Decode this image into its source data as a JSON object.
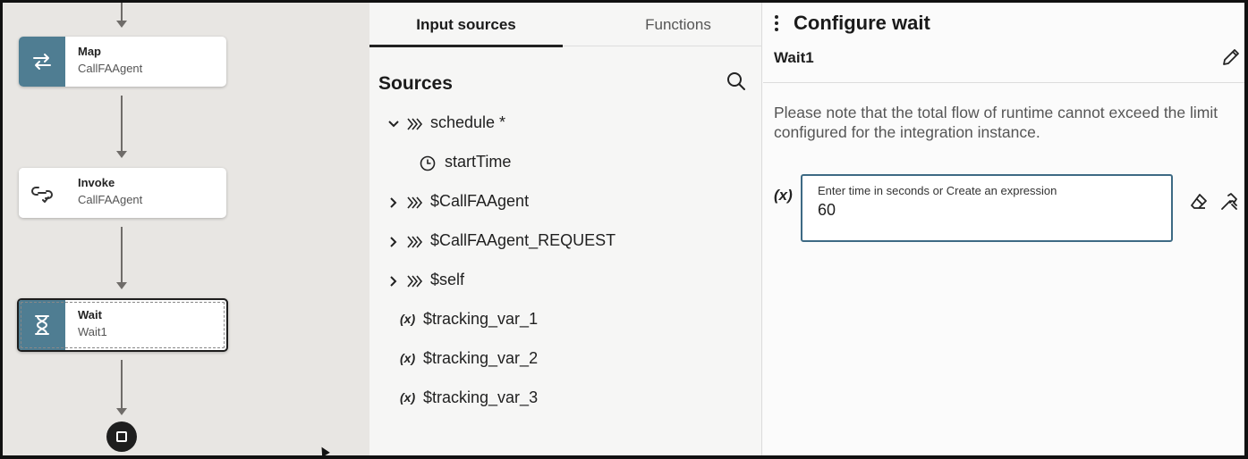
{
  "canvas": {
    "nodes": [
      {
        "icon": "map-arrows-icon",
        "title": "Map",
        "subtitle": "CallFAAgent"
      },
      {
        "icon": "invoke-link-icon",
        "title": "Invoke",
        "subtitle": "CallFAAgent"
      },
      {
        "icon": "hourglass-icon",
        "title": "Wait",
        "subtitle": "Wait1",
        "selected": true
      }
    ],
    "end_icon": "stop-square-icon",
    "accent": "#4f7d92"
  },
  "mapper": {
    "tabs": [
      {
        "label": "Input sources",
        "active": true
      },
      {
        "label": "Functions",
        "active": false
      }
    ],
    "sources_title": "Sources",
    "search_icon": "search-icon",
    "tree": [
      {
        "label": "schedule *",
        "icon": "object-icon",
        "expanded": true
      },
      {
        "label": "startTime",
        "icon": "clock-icon"
      },
      {
        "label": "$CallFAAgent",
        "icon": "object-icon",
        "expanded": false
      },
      {
        "label": "$CallFAAgent_REQUEST",
        "icon": "object-icon",
        "expanded": false
      },
      {
        "label": "$self",
        "icon": "object-icon",
        "expanded": false
      },
      {
        "label": "$tracking_var_1",
        "icon": "variable-icon",
        "glyph": "(x)"
      },
      {
        "label": "$tracking_var_2",
        "icon": "variable-icon",
        "glyph": "(x)"
      },
      {
        "label": "$tracking_var_3",
        "icon": "variable-icon",
        "glyph": "(x)"
      }
    ]
  },
  "config": {
    "title": "Configure wait",
    "name": "Wait1",
    "note": "Please note that the total flow of runtime cannot exceed the limit configured for the integration instance.",
    "fx_label": "(x)",
    "field_label": "Enter time in seconds or Create an expression",
    "field_value": "60",
    "border_color": "#3d6a84"
  }
}
